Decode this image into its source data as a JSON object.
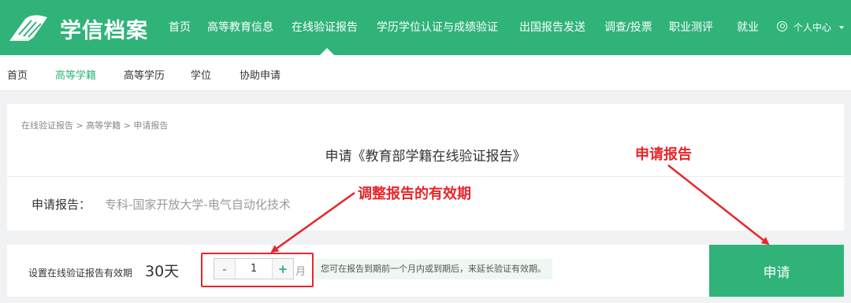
{
  "brand": {
    "name": "学信档案"
  },
  "topnav": [
    "首页",
    "高等教育信息",
    "在线验证报告",
    "学历学位认证与成绩验证",
    "出国报告发送",
    "调查/投票",
    "职业测评",
    "就业",
    "个人中心"
  ],
  "subnav": {
    "items": [
      "首页",
      "高等学籍",
      "高等学历",
      "学位",
      "协助申请"
    ],
    "active_index": 1
  },
  "breadcrumb": "在线验证报告 > 高等学籍 > 申请报告",
  "page_title": "申请《教育部学籍在线验证报告》",
  "apply": {
    "label": "申请报告：",
    "value": "专科-国家开放大学-电气自动化技术"
  },
  "validity": {
    "label": "设置在线验证报告有效期",
    "days": "30天",
    "minus": "-",
    "months": "1",
    "plus": "+",
    "unit": "月",
    "hint": "您可在报告到期前一个月内或到期后，来延长验证有效期。"
  },
  "submit_label": "申请",
  "annotations": {
    "adjust": "调整报告的有效期",
    "apply": "申请报告"
  },
  "colors": {
    "brand_green": "#2fb379",
    "annotation_red": "#e8262a"
  },
  "icons": {
    "logo": "book-logo-icon",
    "user": "user-circle-icon",
    "dropdown": "caret-down-icon"
  }
}
